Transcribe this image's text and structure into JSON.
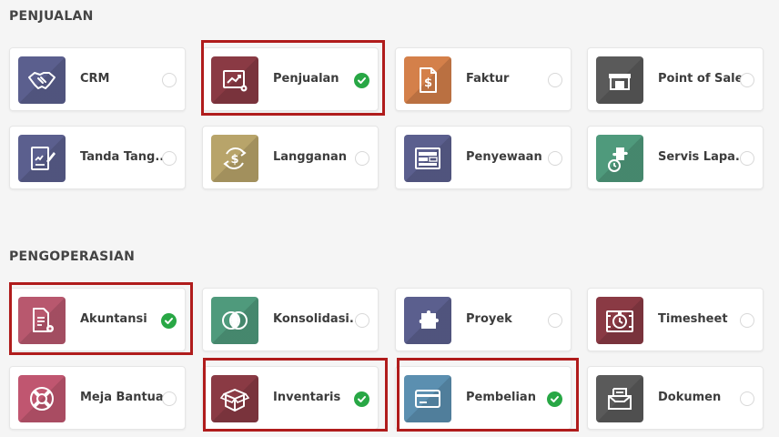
{
  "sections": {
    "penjualan_title": "PENJUALAN",
    "pengoperasian_title": "PENGOPERASIAN"
  },
  "apps": {
    "crm": {
      "label": "CRM",
      "icon": "handshake-icon",
      "color": "#5b5f8e",
      "selected": false
    },
    "penjualan": {
      "label": "Penjualan",
      "icon": "sales-chart-icon",
      "color": "#8a3a44",
      "selected": true
    },
    "faktur": {
      "label": "Faktur",
      "icon": "invoice-dollar-icon",
      "color": "#d4804a",
      "selected": false
    },
    "pos": {
      "label": "Point of Sale",
      "icon": "store-icon",
      "color": "#5a5a5a",
      "selected": false
    },
    "tanda_tangan": {
      "label": "Tanda Tang...",
      "icon": "sign-document-icon",
      "color": "#5b5f8e",
      "selected": false
    },
    "langganan": {
      "label": "Langganan",
      "icon": "subscription-icon",
      "color": "#b8a46a",
      "selected": false
    },
    "penyewaan": {
      "label": "Penyewaan",
      "icon": "rental-calendar-icon",
      "color": "#5b5f8e",
      "selected": false
    },
    "servis": {
      "label": "Servis Lapa...",
      "icon": "field-service-icon",
      "color": "#4f9a7c",
      "selected": false
    },
    "akuntansi": {
      "label": "Akuntansi",
      "icon": "accounting-doc-icon",
      "color": "#b8586e",
      "selected": true
    },
    "konsolidasi": {
      "label": "Konsolidasi...",
      "icon": "consolidation-icon",
      "color": "#4f9a7c",
      "selected": false
    },
    "proyek": {
      "label": "Proyek",
      "icon": "puzzle-icon",
      "color": "#5b5f8e",
      "selected": false
    },
    "timesheet": {
      "label": "Timesheet",
      "icon": "stopwatch-icon",
      "color": "#8a3a44",
      "selected": false
    },
    "meja_bantuan": {
      "label": "Meja Bantuan",
      "icon": "lifebuoy-icon",
      "color": "#c05670",
      "selected": false
    },
    "inventaris": {
      "label": "Inventaris",
      "icon": "box-icon",
      "color": "#8a3a44",
      "selected": true
    },
    "pembelian": {
      "label": "Pembelian",
      "icon": "credit-card-icon",
      "color": "#5b8fb0",
      "selected": true
    },
    "dokumen": {
      "label": "Dokumen",
      "icon": "document-tray-icon",
      "color": "#5a5a5a",
      "selected": false
    }
  },
  "colors": {
    "check_green": "#28a745",
    "highlight_red": "#b01c1c"
  }
}
